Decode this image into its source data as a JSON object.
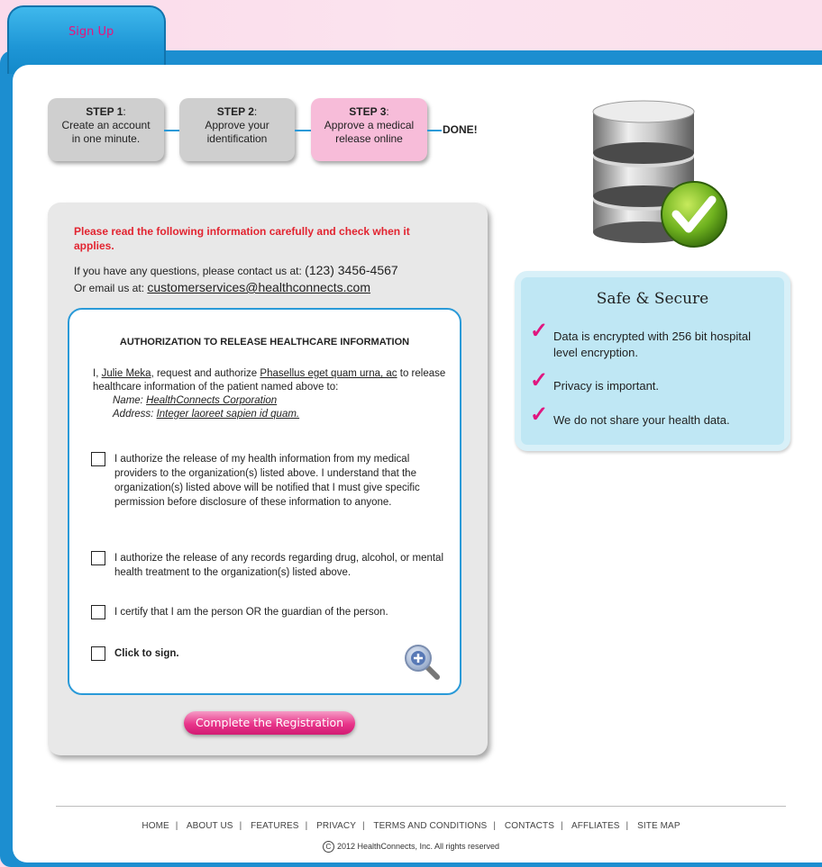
{
  "tab": {
    "label": "Sign Up"
  },
  "steps": [
    {
      "title": "STEP 1",
      "suffix": ":",
      "line1": "Create an account",
      "line2": "in one minute."
    },
    {
      "title": "STEP 2",
      "suffix": ":",
      "line1": "Approve your",
      "line2": "identification"
    },
    {
      "title": "STEP 3",
      "suffix": ":",
      "line1": "Approve a medical",
      "line2": "release online"
    }
  ],
  "done_label": "DONE!",
  "secure": {
    "title": "Safe & Secure",
    "items": [
      "Data is encrypted with 256 bit hospital level encryption.",
      "Privacy is important.",
      "We do not share your health data."
    ]
  },
  "form": {
    "warning": "Please read the following information carefully and check when it applies.",
    "contact_prefix": "If you have any questions, please contact us at: ",
    "phone": "(123) 3456-4567",
    "email_prefix": "Or email us at: ",
    "email": "customerservices@healthconnects.com",
    "auth": {
      "title": "AUTHORIZATION TO RELEASE HEALTHCARE INFORMATION",
      "p_i": "I, ",
      "name": "Julie Meka",
      "p_request": ", request and authorize ",
      "requester": "Phasellus eget quam urna, ac",
      "p_to": " to release healthcare information of the patient named above to:",
      "name_label": "Name: ",
      "org_name": "HealthConnects Corporation",
      "address_label": "Address: ",
      "address": "Integer laoreet sapien id quam.",
      "checkboxes": [
        {
          "text": "I authorize the release of my health information from my medical providers to the organization(s) listed above. I understand that the organization(s) listed above will be notified that I must give specific permission before disclosure of these information to anyone.",
          "checked": false
        },
        {
          "text": "I authorize the release of any records regarding drug, alcohol, or mental health treatment to the organization(s) listed above.",
          "checked": false
        },
        {
          "text": "I certify that I am the person OR the guardian of the person.",
          "checked": false
        },
        {
          "text": "Click to sign.",
          "checked": false
        }
      ]
    },
    "submit_label": "Complete the Registration"
  },
  "footer": {
    "links": [
      "HOME",
      "ABOUT US",
      "FEATURES",
      "PRIVACY",
      "TERMS AND CONDITIONS",
      "CONTACTS",
      "AFFLIATES",
      "SITE MAP"
    ],
    "copyright": "2012 HealthConnects, Inc.  All rights reserved",
    "copyright_symbol": "C"
  },
  "colors": {
    "accent_blue": "#1c8ed0",
    "brand_pink": "#e8137d",
    "warning_red": "#e22430",
    "secure_bg": "#bfe7f4",
    "step_active": "#f7bcd9"
  }
}
